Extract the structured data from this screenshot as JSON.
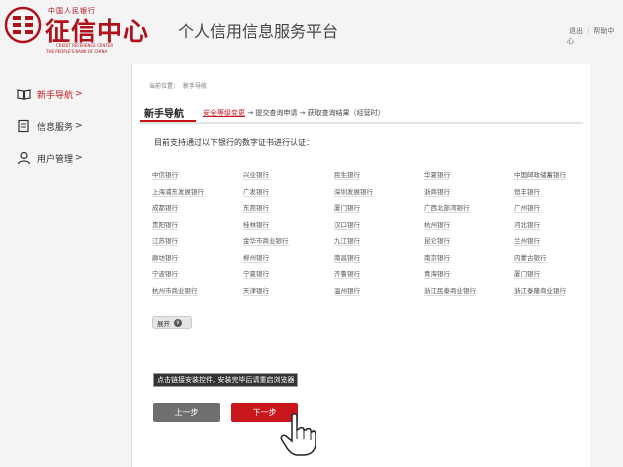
{
  "header": {
    "logo_top": "中国人民银行",
    "logo_main": "征信中心",
    "logo_en1": "CREDIT REFERENCE CENTER",
    "logo_en2": "THE PEOPLE'S BANK OF CHINA",
    "platform_title": "个人信用信息服务平台",
    "links": {
      "logout": "退出",
      "sep": "|",
      "help": "帮助中心"
    }
  },
  "sidebar": {
    "items": [
      {
        "label": "新手导航",
        "arrow": ">",
        "icon": "book-icon",
        "active": true
      },
      {
        "label": "信息服务",
        "arrow": ">",
        "icon": "document-icon",
        "active": false
      },
      {
        "label": "用户管理",
        "arrow": ">",
        "icon": "user-icon",
        "active": false
      }
    ]
  },
  "breadcrumb": {
    "label": "当前位置：",
    "current": "新手导航"
  },
  "tab": {
    "title": "新手导航",
    "steps": {
      "current": "安全等级变更",
      "arrow1": " → ",
      "step2": "提交查询申请",
      "arrow2": " → ",
      "step3": "获取查询结果（经营时）"
    }
  },
  "intro": "目前支持通过以下银行的数字证书进行认证：",
  "banks": [
    [
      "中信银行",
      "兴业银行",
      "民生银行",
      "华夏银行",
      "中国邮政储蓄银行"
    ],
    [
      "上海浦东发展银行",
      "广发银行",
      "深圳发展银行",
      "浙商银行",
      "恒丰银行"
    ],
    [
      "成都银行",
      "东莞银行",
      "厦门银行",
      "广西北部湾银行",
      "广州银行"
    ],
    [
      "贵阳银行",
      "桂林银行",
      "汉口银行",
      "杭州银行",
      "河北银行"
    ],
    [
      "江苏银行",
      "金华市商业银行",
      "九江银行",
      "昆仑银行",
      "兰州银行"
    ],
    [
      "廊坊银行",
      "柳州银行",
      "南昌银行",
      "南京银行",
      "内蒙古银行"
    ],
    [
      "宁波银行",
      "宁夏银行",
      "齐鲁银行",
      "青海银行",
      "厦门银行"
    ],
    [
      "杭州市商业银行",
      "天津银行",
      "温州银行",
      "浙江民泰商业银行",
      "浙江泰隆商业银行"
    ]
  ],
  "expand": {
    "label": "展开",
    "icon": "chevron-down-icon"
  },
  "install_link": "点击链接安装控件, 安装完毕后请重启浏览器",
  "buttons": {
    "prev": "上一步",
    "next": "下一步"
  },
  "colors": {
    "accent": "#c8161d",
    "prev_button": "#6f6f6f"
  }
}
